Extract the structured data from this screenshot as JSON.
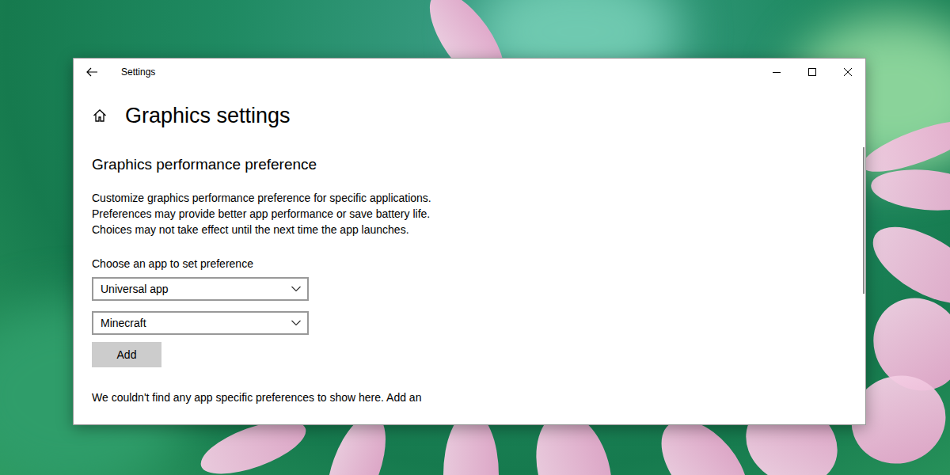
{
  "window": {
    "title": "Settings"
  },
  "page": {
    "title": "Graphics settings"
  },
  "section": {
    "title": "Graphics performance preference",
    "description": "Customize graphics performance preference for specific applications. Preferences may provide better app performance or save battery life. Choices may not take effect until the next time the app launches.",
    "choose_label": "Choose an app to set preference"
  },
  "dropdowns": [
    {
      "value": "Universal app"
    },
    {
      "value": "Minecraft"
    }
  ],
  "add_button": "Add",
  "empty_message": "We couldn't find any app specific preferences to show here. Add an"
}
